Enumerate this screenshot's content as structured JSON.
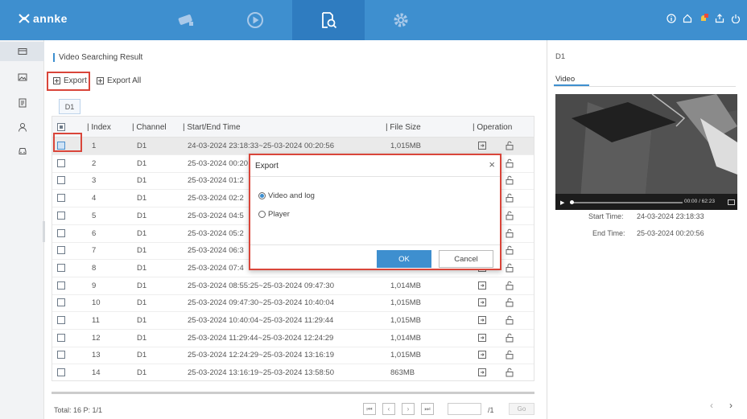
{
  "brand": {
    "name": "annke"
  },
  "nav": {
    "tabs": [
      "live-view-icon",
      "playback-icon",
      "search-icon",
      "settings-icon"
    ],
    "active": 2
  },
  "top_right_icons": [
    "info-icon",
    "home-icon",
    "alarm-icon",
    "logout-icon",
    "power-icon"
  ],
  "sidebar": {
    "items": [
      "video-icon",
      "picture-icon",
      "log-icon",
      "person-icon",
      "vehicle-icon"
    ],
    "active": 0
  },
  "panel": {
    "title": "Video Searching Result"
  },
  "toolbar": {
    "export_label": "Export",
    "export_all_label": "Export All"
  },
  "channel_tab": "D1",
  "table": {
    "columns": [
      "Index",
      "Channel",
      "Start/End Time",
      "File Size",
      "Operation"
    ],
    "rows": [
      {
        "index": "1",
        "channel": "D1",
        "time": "24-03-2024 23:18:33~25-03-2024 00:20:56",
        "size": "1,015MB",
        "checked": true
      },
      {
        "index": "2",
        "channel": "D1",
        "time": "25-03-2024 00:20",
        "size": "",
        "checked": false
      },
      {
        "index": "3",
        "channel": "D1",
        "time": "25-03-2024 01:2",
        "size": "",
        "checked": false
      },
      {
        "index": "4",
        "channel": "D1",
        "time": "25-03-2024 02:2",
        "size": "",
        "checked": false
      },
      {
        "index": "5",
        "channel": "D1",
        "time": "25-03-2024 04:5",
        "size": "",
        "checked": false
      },
      {
        "index": "6",
        "channel": "D1",
        "time": "25-03-2024 05:2",
        "size": "",
        "checked": false
      },
      {
        "index": "7",
        "channel": "D1",
        "time": "25-03-2024 06:3",
        "size": "",
        "checked": false
      },
      {
        "index": "8",
        "channel": "D1",
        "time": "25-03-2024 07:4",
        "size": "",
        "checked": false
      },
      {
        "index": "9",
        "channel": "D1",
        "time": "25-03-2024 08:55:25~25-03-2024 09:47:30",
        "size": "1,014MB",
        "checked": false
      },
      {
        "index": "10",
        "channel": "D1",
        "time": "25-03-2024 09:47:30~25-03-2024 10:40:04",
        "size": "1,015MB",
        "checked": false
      },
      {
        "index": "11",
        "channel": "D1",
        "time": "25-03-2024 10:40:04~25-03-2024 11:29:44",
        "size": "1,015MB",
        "checked": false
      },
      {
        "index": "12",
        "channel": "D1",
        "time": "25-03-2024 11:29:44~25-03-2024 12:24:29",
        "size": "1,014MB",
        "checked": false
      },
      {
        "index": "13",
        "channel": "D1",
        "time": "25-03-2024 12:24:29~25-03-2024 13:16:19",
        "size": "1,015MB",
        "checked": false
      },
      {
        "index": "14",
        "channel": "D1",
        "time": "25-03-2024 13:16:19~25-03-2024 13:58:50",
        "size": "863MB",
        "checked": false
      }
    ]
  },
  "footer": {
    "total": "Total: 16  P: 1/1",
    "page_of": "/1",
    "go_label": "Go"
  },
  "preview": {
    "channel": "D1",
    "tab": "Video",
    "time_display": "00:00 / 62:23",
    "start_label": "Start Time:",
    "start_value": "24-03-2024 23:18:33",
    "end_label": "End Time:",
    "end_value": "25-03-2024 00:20:56"
  },
  "dialog": {
    "title": "Export",
    "options": [
      "Video and log",
      "Player"
    ],
    "selected": 0,
    "ok_label": "OK",
    "cancel_label": "Cancel"
  },
  "colors": {
    "accent": "#3e8fcf",
    "highlight": "#d9453a"
  }
}
